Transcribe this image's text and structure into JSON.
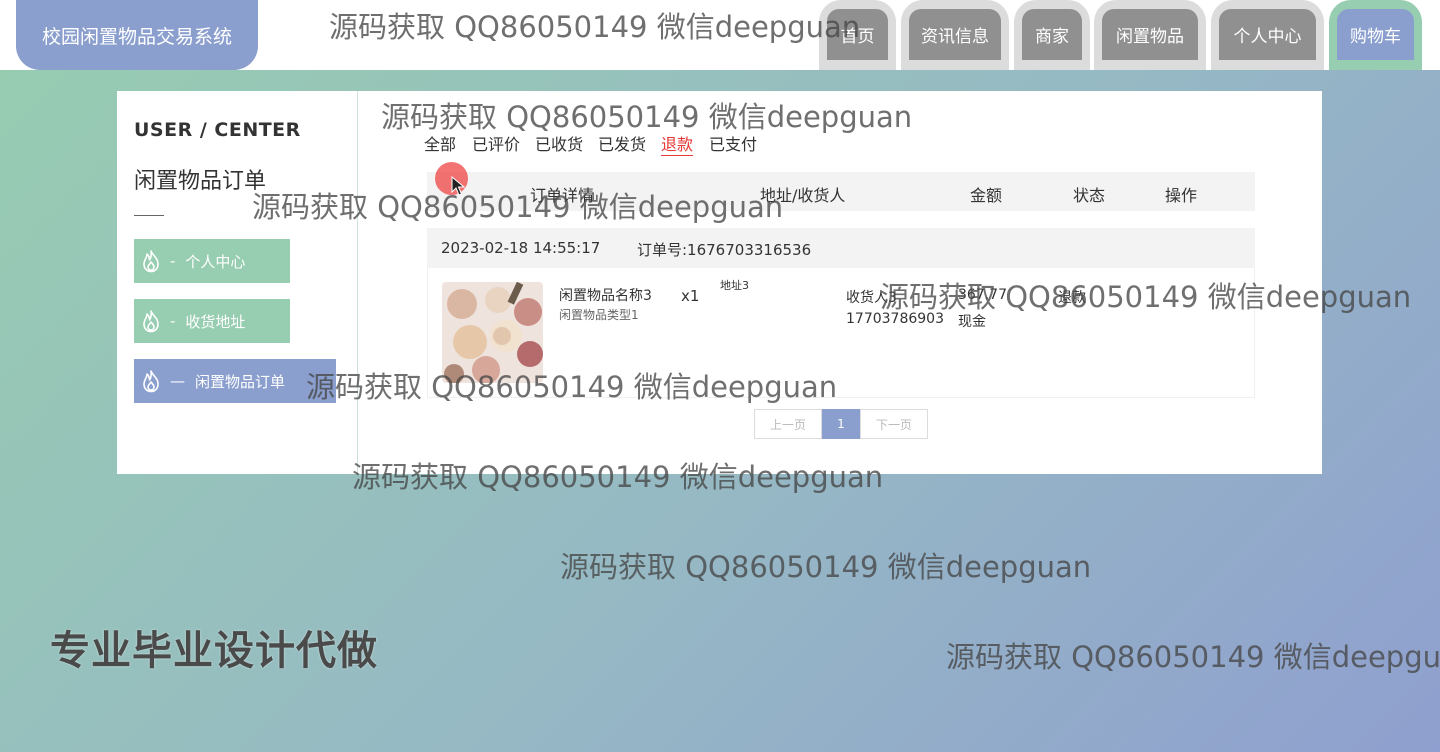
{
  "app": {
    "title": "校园闲置物品交易系统"
  },
  "nav": {
    "items": [
      {
        "label": "首页",
        "active": false
      },
      {
        "label": "资讯信息",
        "active": false
      },
      {
        "label": "商家",
        "active": false
      },
      {
        "label": "闲置物品",
        "active": false
      },
      {
        "label": "个人中心",
        "active": false
      },
      {
        "label": "购物车",
        "active": true
      }
    ]
  },
  "sidebar": {
    "heading": "USER / CENTER",
    "subheading": "闲置物品订单",
    "items": [
      {
        "label": "个人中心",
        "prefix": "-",
        "active": false,
        "icon": "flame-icon"
      },
      {
        "label": "收货地址",
        "prefix": "-",
        "active": false,
        "icon": "flame-icon"
      },
      {
        "label": "闲置物品订单",
        "prefix": "—",
        "active": true,
        "icon": "flame-icon"
      }
    ]
  },
  "filters": {
    "active": "退款",
    "items": [
      "全部",
      "已评价",
      "已收货",
      "已发货",
      "退款",
      "已支付"
    ]
  },
  "table": {
    "columns": [
      "订单详情",
      "地址/收货人",
      "金额",
      "状态",
      "操作"
    ]
  },
  "orders": [
    {
      "date": "2023-02-18 14:55:17",
      "order_no": "订单号:1676703316536",
      "product_name": "闲置物品名称3",
      "product_type": "闲置物品类型1",
      "quantity": "x1",
      "address": "地址3",
      "receiver": "收货人3",
      "phone": "17703786903",
      "amount": "367.77",
      "payment": "现金",
      "status": "退款"
    }
  ],
  "pagination": {
    "prev": "上一页",
    "current": "1",
    "next": "下一页"
  },
  "watermark": "源码获取 QQ86050149 微信deepguan",
  "watermark_cut": "源码获取 QQ86050149 微信deepgu",
  "promo": "专业毕业设计代做",
  "colors": {
    "accent_blue": "#8b9fcf",
    "accent_green": "#97cdb0",
    "active_filter": "#e53935"
  }
}
